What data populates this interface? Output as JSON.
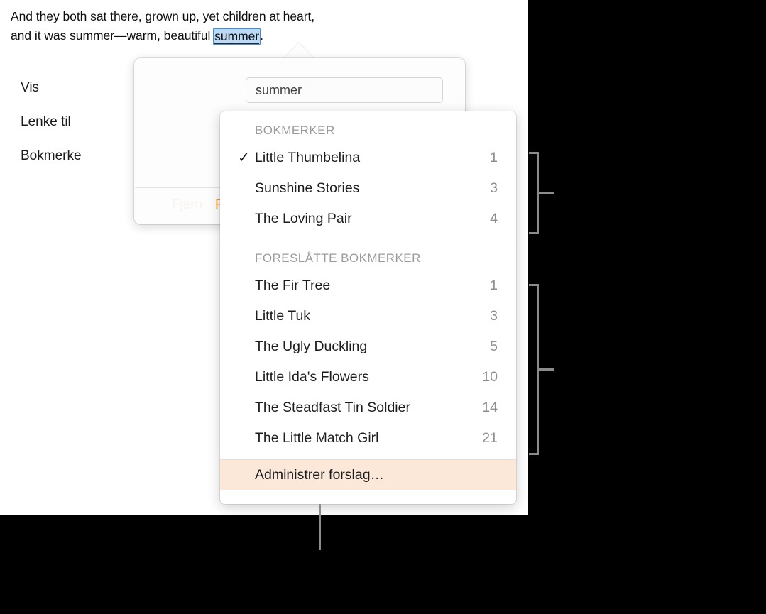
{
  "document": {
    "line1": "And they both sat there, grown up, yet children at heart,",
    "line2_before": "and it was summer—warm, beautiful ",
    "selected_word": "summer",
    "line2_after": "."
  },
  "popover": {
    "labels": {
      "display": "Vis",
      "link_to": "Lenke til",
      "bookmark": "Bokmerke"
    },
    "field": {
      "value": "summer",
      "placeholder": "summer"
    },
    "buttons": {
      "remove": "Fjern",
      "apply": "Fjern"
    }
  },
  "menu": {
    "sections": [
      {
        "title": "BOKMERKER",
        "items": [
          {
            "label": "Little Thumbelina",
            "count": "1",
            "checked": true
          },
          {
            "label": "Sunshine Stories",
            "count": "3",
            "checked": false
          },
          {
            "label": "The Loving Pair",
            "count": "4",
            "checked": false
          }
        ]
      },
      {
        "title": "FORESLÅTTE BOKMERKER",
        "items": [
          {
            "label": "The Fir Tree",
            "count": "1",
            "checked": false
          },
          {
            "label": "Little Tuk",
            "count": "3",
            "checked": false
          },
          {
            "label": "The Ugly Duckling",
            "count": "5",
            "checked": false
          },
          {
            "label": "Little Ida's Flowers",
            "count": "10",
            "checked": false
          },
          {
            "label": "The Steadfast Tin Soldier",
            "count": "14",
            "checked": false
          },
          {
            "label": "The Little Match Girl",
            "count": "21",
            "checked": false
          }
        ]
      }
    ],
    "footer_item": "Administrer forslag…",
    "checkmark_glyph": "✓"
  },
  "colors": {
    "accent_orange": "#f89833",
    "highlight_peach": "#fbe8d8",
    "selection_blue": "#bcd9f5",
    "selection_border": "#3c8ee0",
    "callout_gray": "#8c8c8c",
    "backdrop": "#000000"
  }
}
